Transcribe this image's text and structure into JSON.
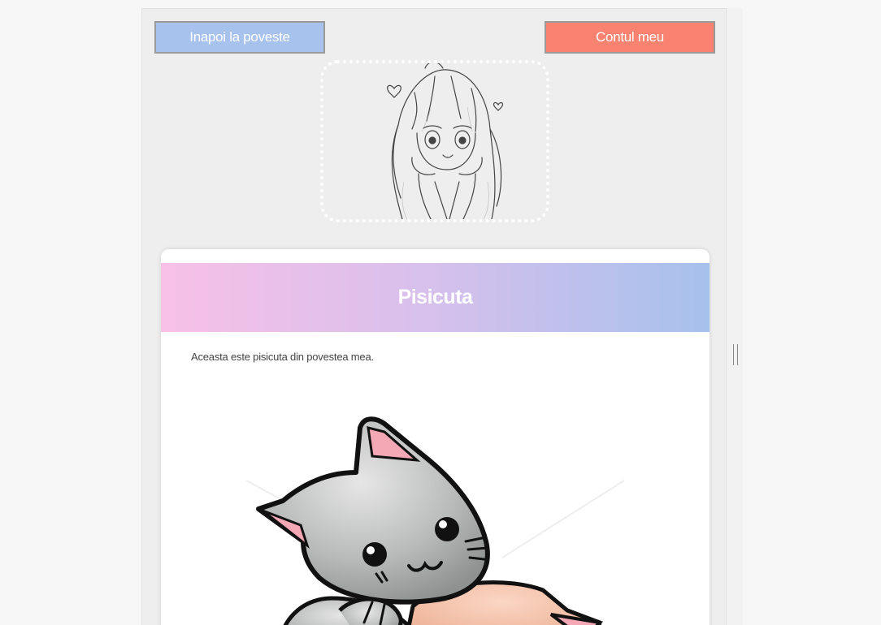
{
  "nav": {
    "back_label": "Inapoi la poveste",
    "account_label": "Contul meu"
  },
  "colors": {
    "back_button": "#a7c2ed",
    "account_button": "#f98370",
    "header_gradient_start": "#f7c0e7",
    "header_gradient_end": "#a6c1ec",
    "page_background": "#eeeeee"
  },
  "profile": {
    "avatar_icon": "anime-girl-sketch"
  },
  "character": {
    "name": "Pisicuta",
    "description": "Aceasta este pisicuta din povestea mea.",
    "image_icon": "gray-kitten-cartoon"
  }
}
